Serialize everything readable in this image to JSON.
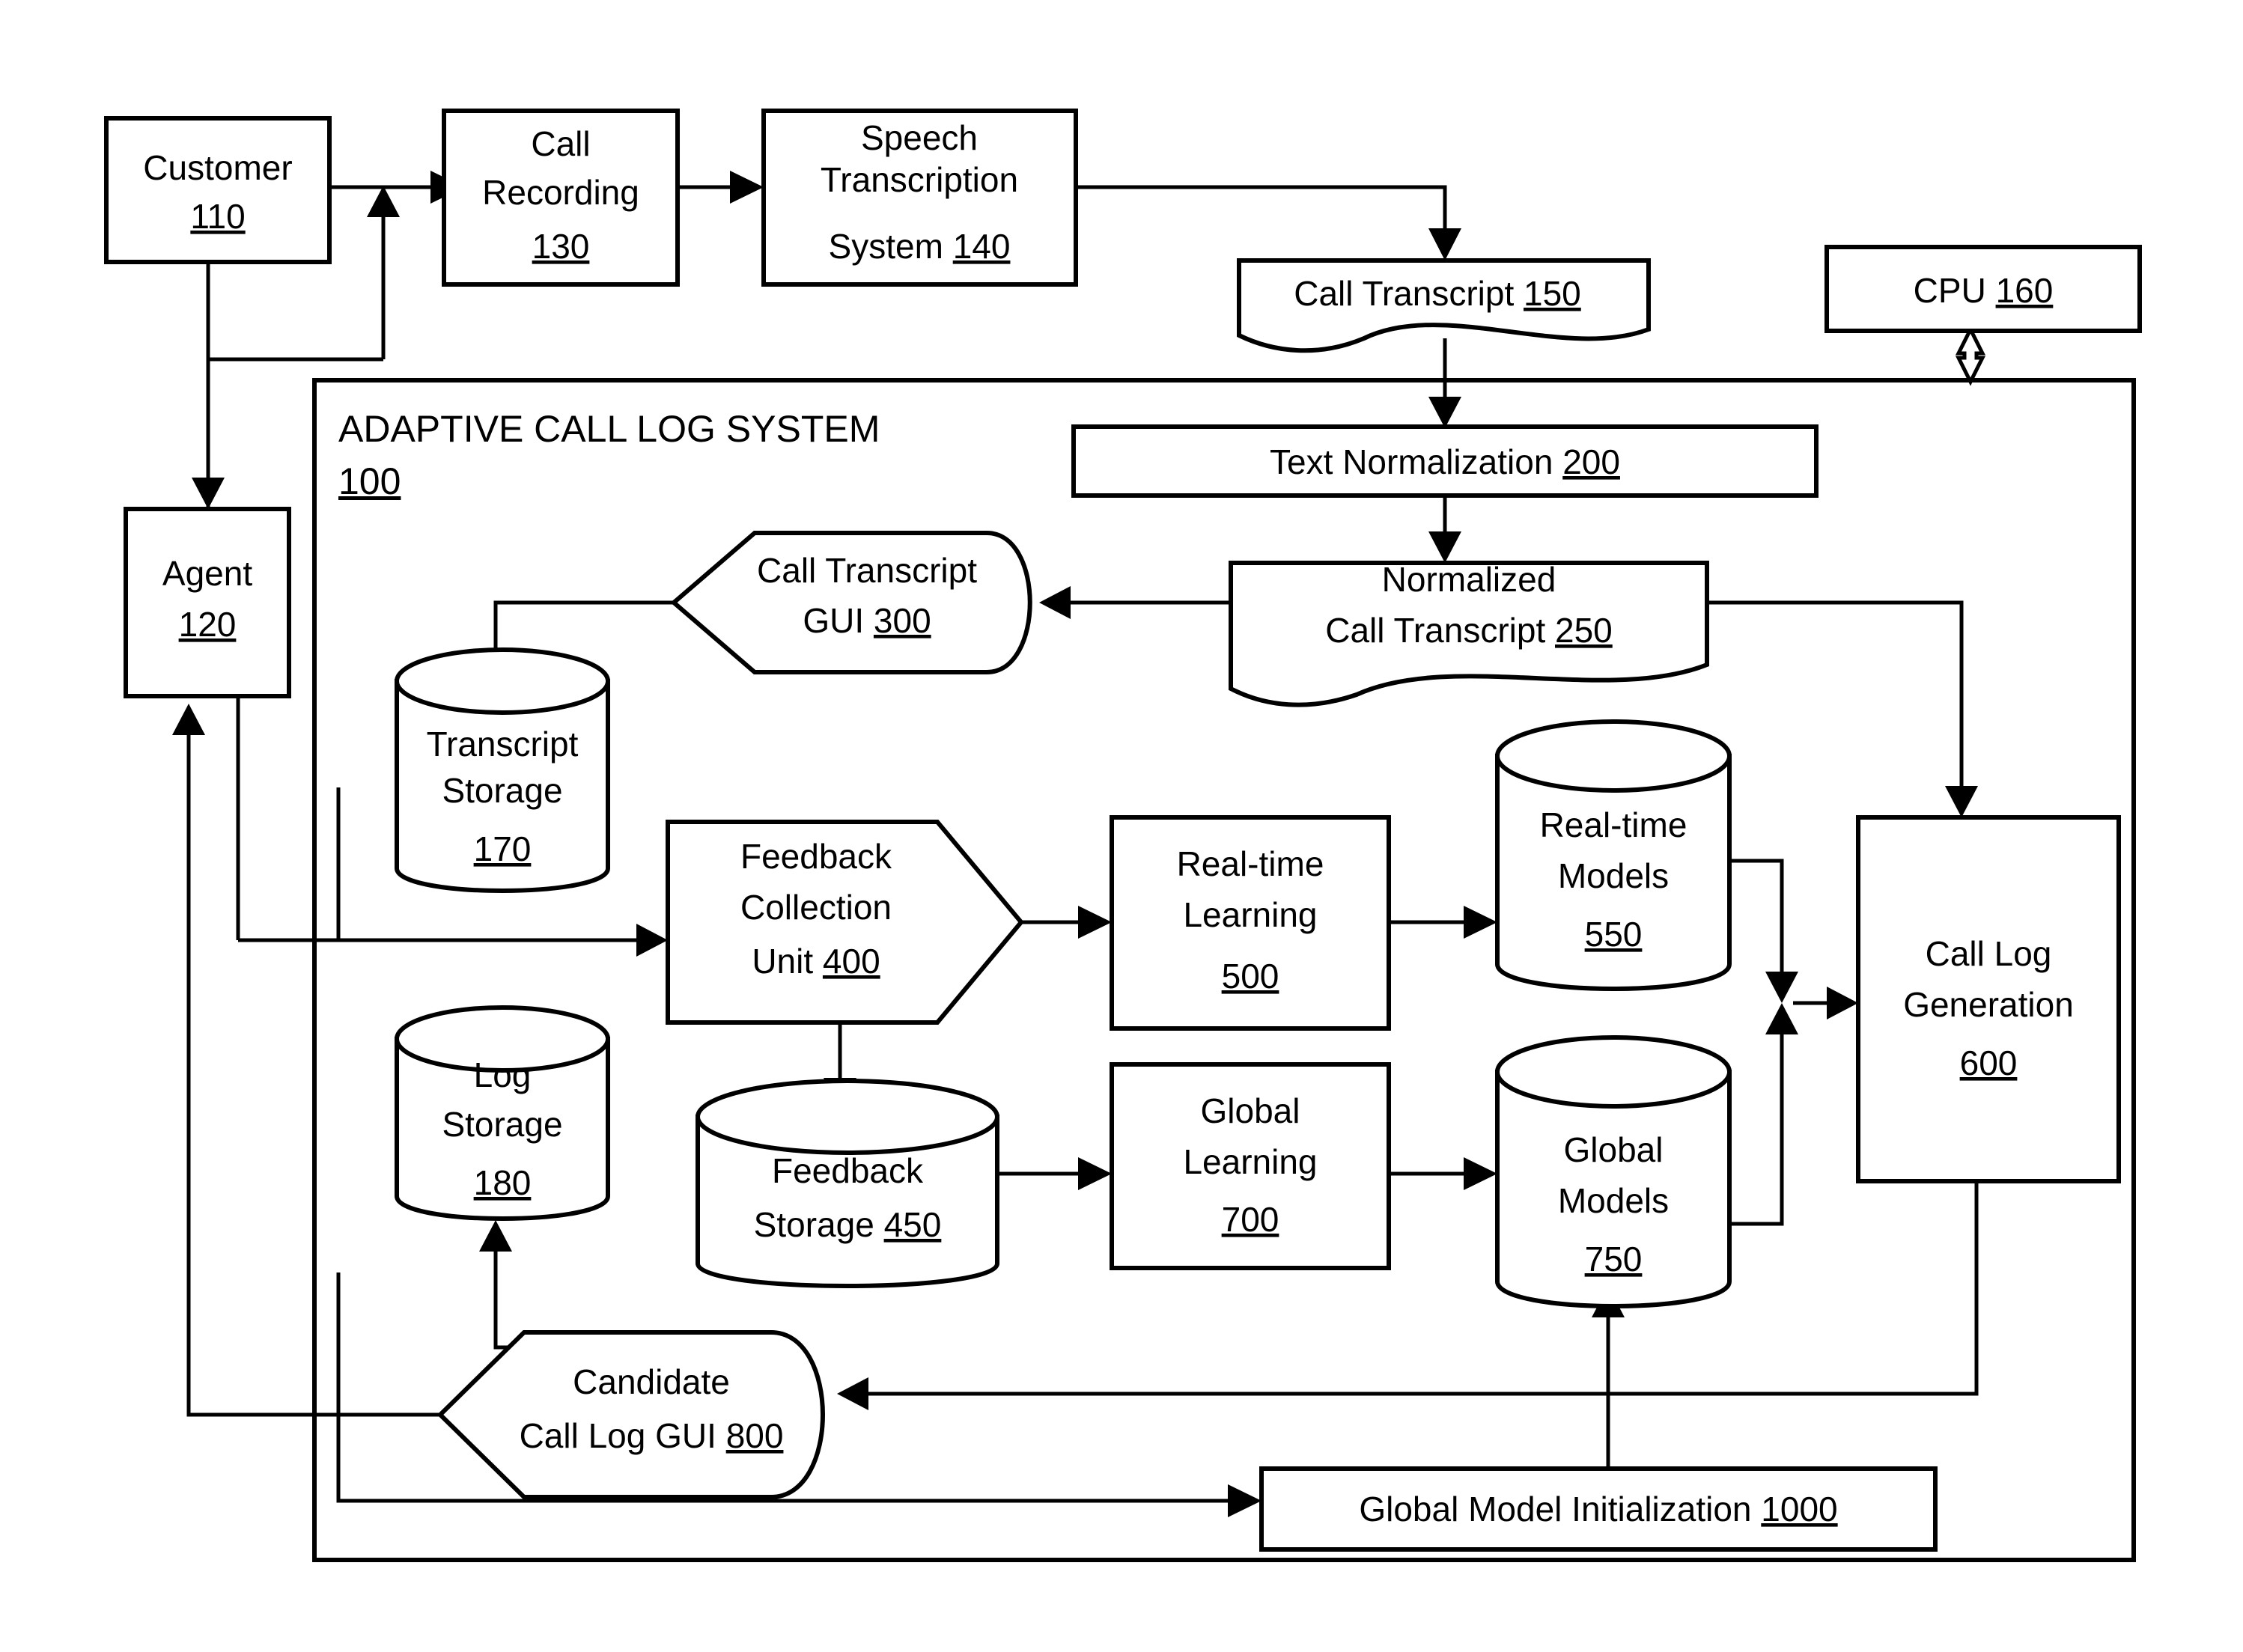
{
  "figure": {
    "system_title": "ADAPTIVE CALL LOG SYSTEM",
    "system_ref": "100"
  },
  "nodes": {
    "customer": {
      "line1": "Customer",
      "ref": "110"
    },
    "agent": {
      "line1": "Agent",
      "ref": "120"
    },
    "call_recording": {
      "line1": "Call",
      "line2": "Recording",
      "ref": "130"
    },
    "speech": {
      "line1": "Speech",
      "line2": "Transcription",
      "line3": "System",
      "ref": "140"
    },
    "call_transcript": {
      "line1": "Call Transcript",
      "ref": "150"
    },
    "cpu": {
      "line1": "CPU",
      "ref": "160"
    },
    "transcript_storage": {
      "line1": "Transcript",
      "line2": "Storage",
      "ref": "170"
    },
    "log_storage": {
      "line1": "Log",
      "line2": "Storage",
      "ref": "180"
    },
    "text_norm": {
      "line1": "Text Normalization",
      "ref": "200"
    },
    "norm_transcript": {
      "line1": "Normalized",
      "line2": "Call Transcript",
      "ref": "250"
    },
    "transcript_gui": {
      "line1": "Call Transcript",
      "line2": "GUI",
      "ref": "300"
    },
    "feedback_unit": {
      "line1": "Feedback",
      "line2": "Collection",
      "line3": "Unit",
      "ref": "400"
    },
    "feedback_storage": {
      "line1": "Feedback",
      "line2": "Storage",
      "ref": "450"
    },
    "realtime_learning": {
      "line1": "Real-time",
      "line2": "Learning",
      "ref": "500"
    },
    "realtime_models": {
      "line1": "Real-time",
      "line2": "Models",
      "ref": "550"
    },
    "call_log_gen": {
      "line1": "Call Log",
      "line2": "Generation",
      "ref": "600"
    },
    "global_learning": {
      "line1": "Global",
      "line2": "Learning",
      "ref": "700"
    },
    "global_models": {
      "line1": "Global",
      "line2": "Models",
      "ref": "750"
    },
    "candidate_gui": {
      "line1": "Candidate",
      "line2": "Call Log GUI",
      "ref": "800"
    },
    "global_init": {
      "line1": "Global Model Initialization",
      "ref": "1000"
    }
  },
  "style": {
    "stroke": "#000000",
    "background": "#ffffff"
  }
}
